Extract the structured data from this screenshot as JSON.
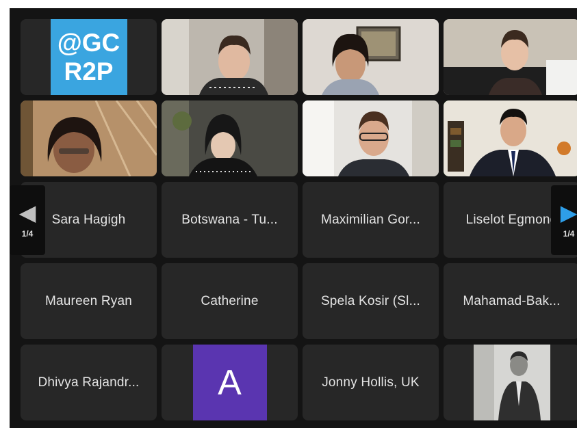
{
  "logo": {
    "line1": "@GC",
    "line2": "R2P"
  },
  "tiles_names": [
    "Sara Hagigh",
    "Botswana - Tu...",
    "Maximilian Gor...",
    "Liselot Egmond",
    "Maureen Ryan",
    "Catherine",
    "Spela Kosir (Sl...",
    "Mahamad-Bak...",
    "Dhivya Rajandr...",
    "Jonny Hollis, UK"
  ],
  "avatar_letter": "A",
  "pagination": {
    "left": "1/4",
    "right": "1/4"
  },
  "colors": {
    "active_border": "#5ad05a",
    "nav_arrow_right": "#2e9ee8",
    "logo_bg": "#3aa5e0",
    "avatar_bg": "#5a35b0"
  },
  "icons": {
    "prev": "chevron-left-icon",
    "next": "chevron-right-icon"
  }
}
